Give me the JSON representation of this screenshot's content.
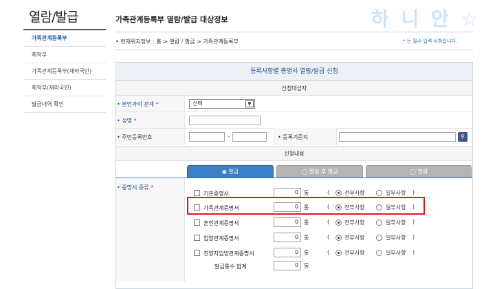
{
  "sidebar": {
    "title": "열람/발급",
    "items": [
      {
        "label": "가족관계등록부",
        "active": true
      },
      {
        "label": "제적부",
        "active": false
      },
      {
        "label": "가족관계등록부(재외국민)",
        "active": false
      },
      {
        "label": "제적부(재외국민)",
        "active": false
      },
      {
        "label": "발급내역 확인",
        "active": false
      }
    ]
  },
  "header": {
    "title": "가족관계등록부 열람/발급 대상정보",
    "deco_text": "하 니 안 ☆",
    "location": "• 현재위치정보 : 홈 > 열람 / 발급 > 가족관계등록부",
    "required_note": "* 는 필수 입력 사항입니다."
  },
  "form": {
    "heading": "등록사항별 증명서 열람/발급 신청",
    "applicant_section": "신청대상자",
    "relation_label": "• 본인과의 관계",
    "relation_value": "선택",
    "name_label": "• 성명",
    "rrn_label": "• 주민등록번호",
    "rrn_sep": "-",
    "base_label": "• 등록기준지",
    "content_section": "신청내용",
    "tabs": [
      {
        "label": "발급",
        "active": true
      },
      {
        "label": "열람 후 발급",
        "active": false
      },
      {
        "label": "열람",
        "active": false
      }
    ],
    "cert_type_label": "• 증명서 종류",
    "req_mark": "*",
    "unit": "통",
    "paren_open": "(",
    "paren_close": ")",
    "opt_full": "전부사항",
    "opt_partial": "일부사항",
    "certs": [
      {
        "name": "기본증명서",
        "count": "0"
      },
      {
        "name": "가족관계증명서",
        "count": "0"
      },
      {
        "name": "혼인관계증명서",
        "count": "0"
      },
      {
        "name": "입양관계증명서",
        "count": "0"
      },
      {
        "name": "친양자입양관계증명서",
        "count": "0"
      }
    ],
    "total_label": "발급통수 합계",
    "total_value": "0"
  },
  "colors": {
    "accent": "#1c62b5",
    "highlight_box": "#e01818",
    "tab_active": "#3e80c8",
    "tab_inactive": "#b4b4b4"
  }
}
